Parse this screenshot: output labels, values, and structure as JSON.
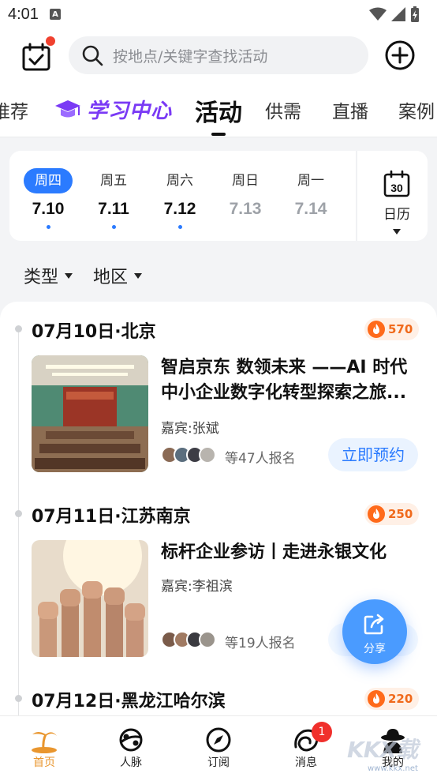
{
  "status": {
    "time": "4:01",
    "a_badge": "A"
  },
  "header": {
    "search_placeholder": "按地点/关键字查找活动"
  },
  "tabs": {
    "recommend": "推荐",
    "study": "学习中心",
    "activity": "活动",
    "supply": "供需",
    "live": "直播",
    "cases": "案例"
  },
  "dates": [
    {
      "weekday": "周四",
      "date": "7.10",
      "selected": true,
      "has_events": true
    },
    {
      "weekday": "周五",
      "date": "7.11",
      "selected": false,
      "has_events": true
    },
    {
      "weekday": "周六",
      "date": "7.12",
      "selected": false,
      "has_events": true
    },
    {
      "weekday": "周日",
      "date": "7.13",
      "selected": false,
      "has_events": false
    },
    {
      "weekday": "周一",
      "date": "7.14",
      "selected": false,
      "has_events": false
    }
  ],
  "calendar_label": "日历",
  "filters": {
    "type": "类型",
    "region": "地区"
  },
  "events": [
    {
      "date_loc": "07月10日·北京",
      "heat": "570",
      "title": "智启京东 数领未来 ——AI 时代中小企业数字化转型探索之旅...",
      "guest": "嘉宾:张斌",
      "registered": "等47人报名",
      "cta": "立即预约"
    },
    {
      "date_loc": "07月11日·江苏南京",
      "heat": "250",
      "title": "标杆企业参访丨走进永银文化",
      "guest": "嘉宾:李祖滨",
      "registered": "等19人报名",
      "cta": ""
    },
    {
      "date_loc": "07月12日·黑龙江哈尔滨",
      "heat": "220"
    }
  ],
  "share_label": "分享",
  "nav": {
    "home": "首页",
    "contacts": "人脉",
    "subscribe": "订阅",
    "messages": "消息",
    "me": "我的",
    "message_badge": "1"
  },
  "watermark": {
    "main": "KKX载",
    "sub": "www.kkx.net"
  },
  "colors": {
    "accent": "#2b7bff",
    "heat": "#ff6a1a",
    "study_purple": "#7a3af5",
    "nav_active": "#e9962e"
  }
}
